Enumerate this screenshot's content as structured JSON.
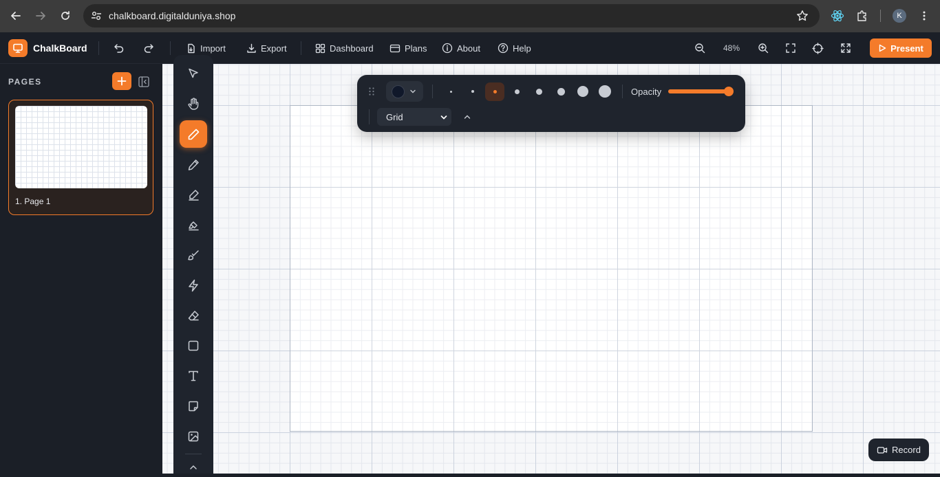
{
  "browser": {
    "url": "chalkboard.digitalduniya.shop",
    "profile_initial": "K",
    "icons": [
      "back-icon",
      "forward-icon",
      "reload-icon",
      "site-info-icon",
      "bookmark-star-icon",
      "react-devtools-icon",
      "extensions-icon",
      "browser-menu-icon"
    ]
  },
  "app": {
    "brand": "ChalkBoard",
    "accent_color": "#f47b2a",
    "nav": {
      "import_label": "Import",
      "export_label": "Export",
      "dashboard_label": "Dashboard",
      "plans_label": "Plans",
      "about_label": "About",
      "help_label": "Help"
    },
    "zoom_level": "48%",
    "present_label": "Present",
    "record_label": "Record"
  },
  "sidebar": {
    "title": "PAGES",
    "pages": [
      {
        "label": "1. Page 1",
        "selected": true
      }
    ]
  },
  "tools": [
    {
      "name": "select",
      "icon": "pointer-icon",
      "active": false
    },
    {
      "name": "pan",
      "icon": "hand-icon",
      "active": false
    },
    {
      "name": "pen",
      "icon": "pen-icon",
      "active": true
    },
    {
      "name": "pencil",
      "icon": "pencil-icon",
      "active": false
    },
    {
      "name": "marker",
      "icon": "marker-icon",
      "active": false
    },
    {
      "name": "highlighter",
      "icon": "highlighter-icon",
      "active": false
    },
    {
      "name": "brush",
      "icon": "brush-icon",
      "active": false
    },
    {
      "name": "laser",
      "icon": "lightning-icon",
      "active": false
    },
    {
      "name": "eraser",
      "icon": "eraser-icon",
      "active": false
    },
    {
      "name": "shape",
      "icon": "square-icon",
      "active": false
    },
    {
      "name": "text",
      "icon": "text-icon",
      "active": false
    },
    {
      "name": "sticky-note",
      "icon": "note-icon",
      "active": false
    },
    {
      "name": "image",
      "icon": "image-icon",
      "active": false
    }
  ],
  "properties": {
    "stroke_color": "#10182a",
    "stroke_sizes_count": 8,
    "selected_size_index": 2,
    "opacity_label": "Opacity",
    "opacity_value": 1.0,
    "background_select": "Grid"
  }
}
